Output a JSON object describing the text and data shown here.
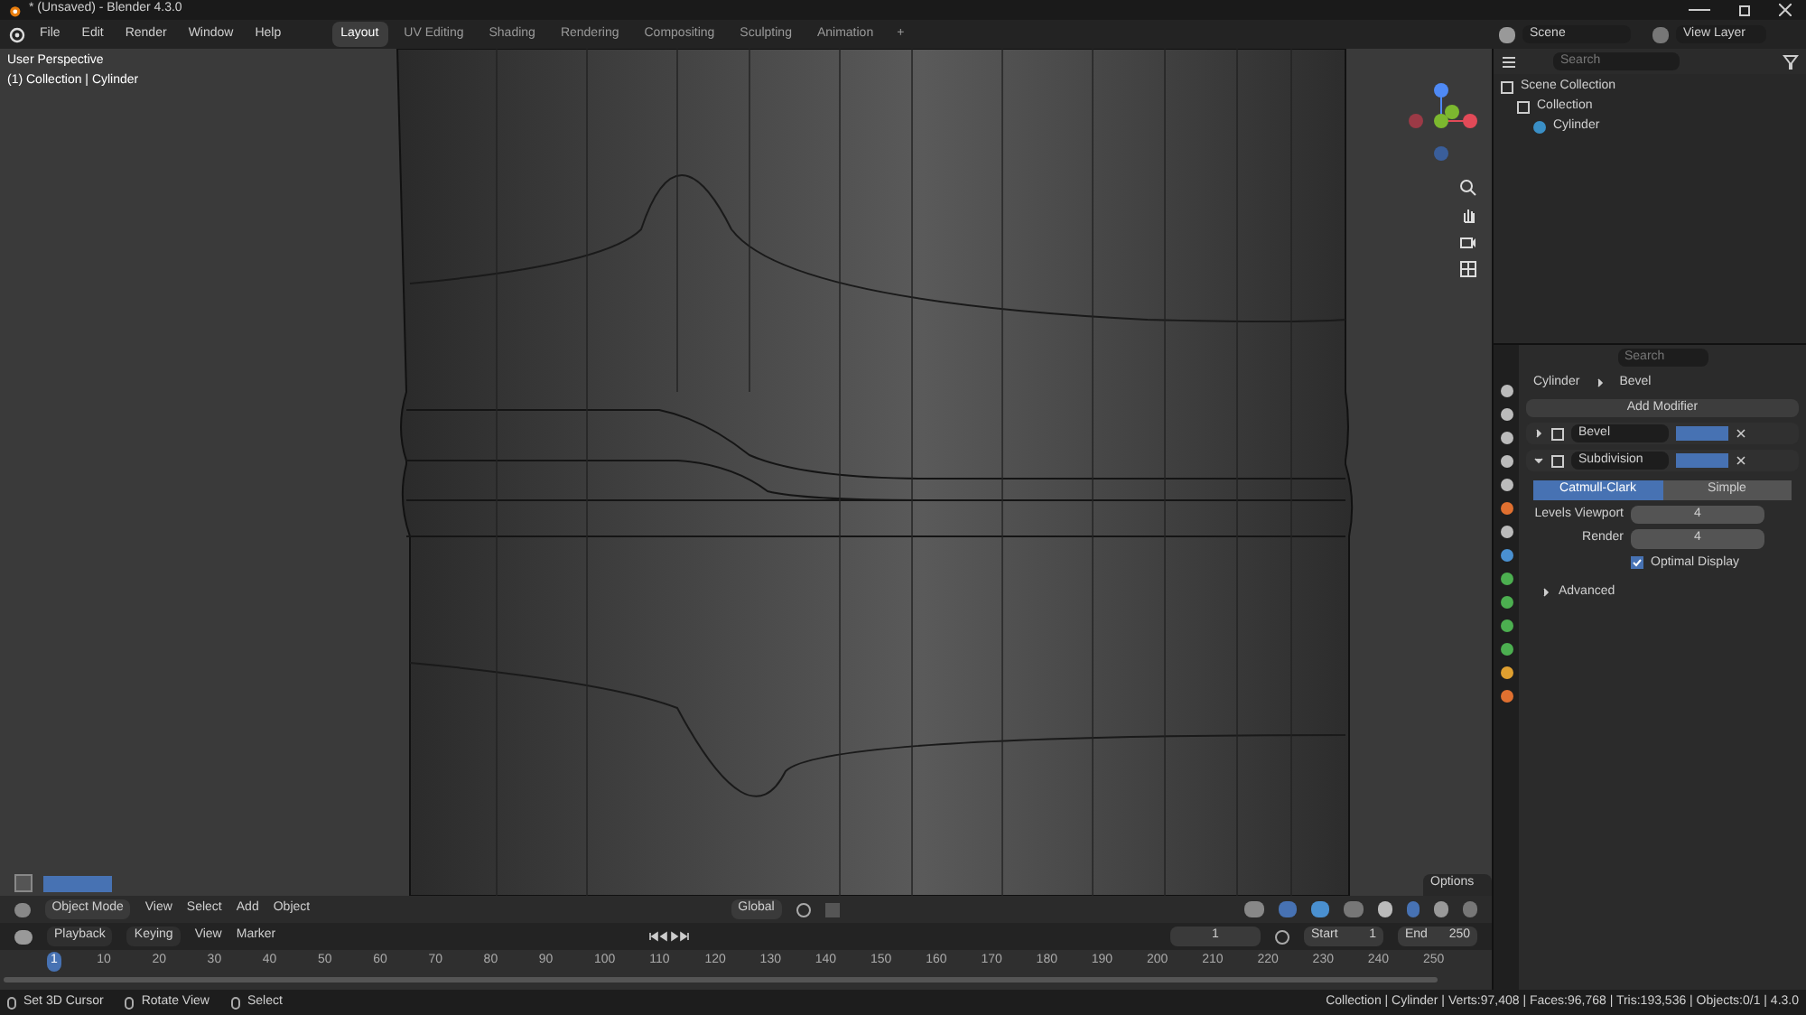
{
  "window": {
    "title": "* (Unsaved) - Blender 4.3.0"
  },
  "menu": [
    "File",
    "Edit",
    "Render",
    "Window",
    "Help"
  ],
  "workspaces": [
    {
      "label": "Layout",
      "selected": true
    },
    {
      "label": "UV Editing",
      "selected": false
    },
    {
      "label": "Shading",
      "selected": false
    },
    {
      "label": "Rendering",
      "selected": false
    },
    {
      "label": "Compositing",
      "selected": false
    },
    {
      "label": "Sculpting",
      "selected": false
    },
    {
      "label": "Animation",
      "selected": false
    }
  ],
  "add_workspace": "+",
  "scene": {
    "scene_name": "Scene",
    "view_layer": "View Layer"
  },
  "viewport": {
    "overlay": [
      "User Perspective",
      "(1) Collection | Cylinder"
    ],
    "mode": "Object Mode",
    "menus": [
      "View",
      "Select",
      "Add",
      "Object"
    ],
    "orientation": "Global",
    "options": "Options"
  },
  "outliner": {
    "search_placeholder": "Search",
    "tree": [
      {
        "label": "Scene Collection",
        "children": [
          {
            "label": "Collection",
            "children": [
              {
                "label": "Cylinder"
              }
            ]
          }
        ]
      }
    ]
  },
  "properties": {
    "search_placeholder": "Search",
    "breadcrumb": [
      "Cylinder",
      "Bevel"
    ],
    "add_modifier": "Add Modifier",
    "modifiers": [
      {
        "name": "Bevel",
        "expanded": false
      },
      {
        "name": "Subdivision",
        "expanded": true
      }
    ],
    "subdivision_types": [
      {
        "label": "Catmull-Clark",
        "selected": true
      },
      {
        "label": "Simple",
        "selected": false
      }
    ],
    "fields": [
      {
        "label": "Levels Viewport",
        "value": "4"
      },
      {
        "label": "Render",
        "value": "4"
      }
    ],
    "optimal_display": {
      "label": "Optimal Display",
      "checked": true
    },
    "advanced": "Advanced"
  },
  "timeline": {
    "menus": [
      "Playback",
      "Keying",
      "View",
      "Marker"
    ],
    "current_frame": "1",
    "start_label": "Start",
    "start": "1",
    "end_label": "End",
    "end": "250",
    "ruler": [
      "1",
      "10",
      "20",
      "30",
      "40",
      "50",
      "60",
      "70",
      "80",
      "90",
      "100",
      "110",
      "120",
      "130",
      "140",
      "150",
      "160",
      "170",
      "180",
      "190",
      "200",
      "210",
      "220",
      "230",
      "240",
      "250"
    ]
  },
  "status_bar": {
    "hints": [
      "Set 3D Cursor",
      "Rotate View",
      "Select"
    ],
    "stats": "Collection | Cylinder | Verts:97,408 | Faces:96,768 | Tris:193,536 | Objects:0/1 | 4.3.0"
  }
}
